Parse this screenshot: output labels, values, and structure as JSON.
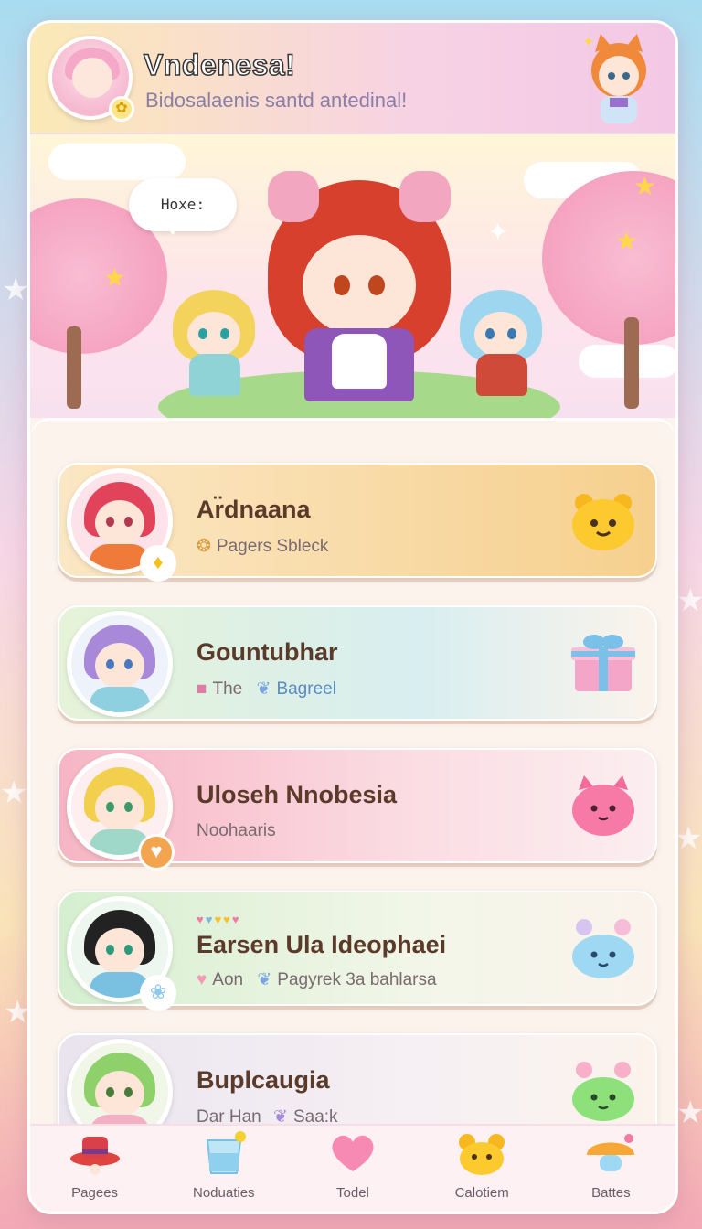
{
  "header": {
    "title": "Vndenesa!",
    "subtitle": "Bidosalaenis santd antedinal!"
  },
  "hero": {
    "speech": "Hoxe:"
  },
  "cards": [
    {
      "name": "Ar̈dnaana",
      "meta": "Pagers Sbleck",
      "meta_icon": "cookie-icon",
      "pet_icon": "bear-face-icon",
      "accent": "#f6c96a"
    },
    {
      "name": "Gountubhar",
      "meta_a": "The",
      "meta_b": "Bagreel",
      "pet_icon": "gift-box-icon",
      "accent": "#b8e3d0"
    },
    {
      "name": "Uloseh Nnobesia",
      "meta": "Noohaaris",
      "pet_icon": "pink-cat-blob-icon",
      "accent": "#f4a7b9"
    },
    {
      "name": "Earsen Ula Ideophaei",
      "meta_a": "Aon",
      "meta_b": "Pagyrek 3a bahlarsa",
      "pet_icon": "blue-slime-icon",
      "accent": "#bfe8c8"
    },
    {
      "name": "Buplcaugia",
      "meta_a": "Dar Han",
      "meta_b": "Saa:k",
      "pet_icon": "green-slime-icon",
      "accent": "#e6d6f2"
    }
  ],
  "nav": [
    {
      "label": "Pagees",
      "icon": "hat-icon"
    },
    {
      "label": "Noduaties",
      "icon": "cup-icon"
    },
    {
      "label": "Todel",
      "icon": "heart-icon"
    },
    {
      "label": "Calotiem",
      "icon": "bear-icon"
    },
    {
      "label": "Battes",
      "icon": "mushroom-icon"
    }
  ]
}
